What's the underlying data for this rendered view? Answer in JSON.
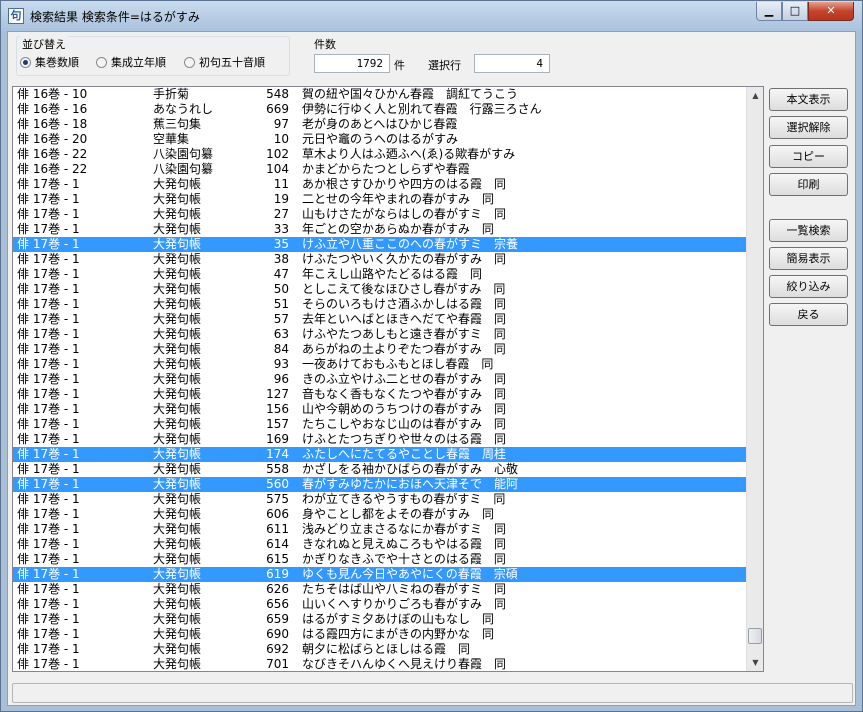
{
  "window": {
    "title": "検索結果 検索条件=はるがすみ",
    "app_icon": "句",
    "minimize": "▁",
    "maximize": "□",
    "close": "✕"
  },
  "sort": {
    "label": "並び替え",
    "options": [
      {
        "label": "集巻数順",
        "selected": true
      },
      {
        "label": "集成立年順",
        "selected": false
      },
      {
        "label": "初句五十音順",
        "selected": false
      }
    ]
  },
  "count": {
    "label": "件数",
    "value": "1792",
    "unit": "件",
    "selected_label": "選択行",
    "selected_value": "4"
  },
  "results": [
    {
      "ref": "俳 16巻 - 10",
      "collection": "手折菊",
      "num": "548",
      "text": "賀の紐や国々ひかん春霞　調紅てうこう",
      "selected": false
    },
    {
      "ref": "俳 16巻 - 16",
      "collection": "あなうれし",
      "num": "669",
      "text": "伊勢に行ゆく人と別れて春霞　行露三ろさん",
      "selected": false
    },
    {
      "ref": "俳 16巻 - 18",
      "collection": "蕉三句集",
      "num": "97",
      "text": "老が身のあとへはひかじ春霞",
      "selected": false
    },
    {
      "ref": "俳 16巻 - 20",
      "collection": "空華集",
      "num": "10",
      "text": "元日や竈のうへのはるがすみ",
      "selected": false
    },
    {
      "ref": "俳 16巻 - 22",
      "collection": "八染園句纂",
      "num": "102",
      "text": "草木より人はふ廼ふへ(ゑ)る歟春がすみ",
      "selected": false
    },
    {
      "ref": "俳 16巻 - 22",
      "collection": "八染園句纂",
      "num": "104",
      "text": "かまどからたつとしらずや春霞",
      "selected": false
    },
    {
      "ref": "俳 17巻 - 1",
      "collection": "大発句帳",
      "num": "11",
      "text": "あか根さすひかりや四方のはる霞　同",
      "selected": false
    },
    {
      "ref": "俳 17巻 - 1",
      "collection": "大発句帳",
      "num": "19",
      "text": "二とせの今年やまれの春がすみ　同",
      "selected": false
    },
    {
      "ref": "俳 17巻 - 1",
      "collection": "大発句帳",
      "num": "27",
      "text": "山もけさたがならはしの春がすミ　同",
      "selected": false
    },
    {
      "ref": "俳 17巻 - 1",
      "collection": "大発句帳",
      "num": "33",
      "text": "年ごとの空かあらぬか春がすみ　同",
      "selected": false
    },
    {
      "ref": "俳 17巻 - 1",
      "collection": "大発句帳",
      "num": "35",
      "text": "けふ立や八重ここのへの春がすミ　宗養",
      "selected": true
    },
    {
      "ref": "俳 17巻 - 1",
      "collection": "大発句帳",
      "num": "38",
      "text": "けふたつやいく久かたの春がすみ　同",
      "selected": false
    },
    {
      "ref": "俳 17巻 - 1",
      "collection": "大発句帳",
      "num": "47",
      "text": "年こえし山路やたどるはる霞　同",
      "selected": false
    },
    {
      "ref": "俳 17巻 - 1",
      "collection": "大発句帳",
      "num": "50",
      "text": "としこえて後なほひさし春がすみ　同",
      "selected": false
    },
    {
      "ref": "俳 17巻 - 1",
      "collection": "大発句帳",
      "num": "51",
      "text": "そらのいろもけさ酒ふかしはる霞　同",
      "selected": false
    },
    {
      "ref": "俳 17巻 - 1",
      "collection": "大発句帳",
      "num": "57",
      "text": "去年といへばとほきへだてや春霞　同",
      "selected": false
    },
    {
      "ref": "俳 17巻 - 1",
      "collection": "大発句帳",
      "num": "63",
      "text": "けふやたつあしもと遠き春がすミ　同",
      "selected": false
    },
    {
      "ref": "俳 17巻 - 1",
      "collection": "大発句帳",
      "num": "84",
      "text": "あらがねの土よりぞたつ春がすみ　同",
      "selected": false
    },
    {
      "ref": "俳 17巻 - 1",
      "collection": "大発句帳",
      "num": "93",
      "text": "一夜あけておもふもとほし春霞　同",
      "selected": false
    },
    {
      "ref": "俳 17巻 - 1",
      "collection": "大発句帳",
      "num": "96",
      "text": "きのふ立やけふ二とせの春がすみ　同",
      "selected": false
    },
    {
      "ref": "俳 17巻 - 1",
      "collection": "大発句帳",
      "num": "127",
      "text": "音もなく香もなくたつや春がすみ　同",
      "selected": false
    },
    {
      "ref": "俳 17巻 - 1",
      "collection": "大発句帳",
      "num": "156",
      "text": "山や今朝めのうちつけの春がすみ　同",
      "selected": false
    },
    {
      "ref": "俳 17巻 - 1",
      "collection": "大発句帳",
      "num": "157",
      "text": "たちこしやおなじ山のは春がすみ　同",
      "selected": false
    },
    {
      "ref": "俳 17巻 - 1",
      "collection": "大発句帳",
      "num": "169",
      "text": "けふとたつちぎりや世々のはる霞　同",
      "selected": false
    },
    {
      "ref": "俳 17巻 - 1",
      "collection": "大発句帳",
      "num": "174",
      "text": "ふたしへにたてるやことし春霞　周桂",
      "selected": true
    },
    {
      "ref": "俳 17巻 - 1",
      "collection": "大発句帳",
      "num": "558",
      "text": "かざしをる袖かひばらの春がすみ　心敬",
      "selected": false
    },
    {
      "ref": "俳 17巻 - 1",
      "collection": "大発句帳",
      "num": "560",
      "text": "春がすみゆたかにおほへ天津そで　能阿",
      "selected": true
    },
    {
      "ref": "俳 17巻 - 1",
      "collection": "大発句帳",
      "num": "575",
      "text": "わが立てきるやうすもの春がすミ　同",
      "selected": false
    },
    {
      "ref": "俳 17巻 - 1",
      "collection": "大発句帳",
      "num": "606",
      "text": "身やことし都をよその春がすみ　同",
      "selected": false
    },
    {
      "ref": "俳 17巻 - 1",
      "collection": "大発句帳",
      "num": "611",
      "text": "浅みどり立まさるなにか春がすミ　同",
      "selected": false
    },
    {
      "ref": "俳 17巻 - 1",
      "collection": "大発句帳",
      "num": "614",
      "text": "きなれぬと見えぬころもやはる霞　同",
      "selected": false
    },
    {
      "ref": "俳 17巻 - 1",
      "collection": "大発句帳",
      "num": "615",
      "text": "かぎりなきふでや十さとのはる霞　同",
      "selected": false
    },
    {
      "ref": "俳 17巻 - 1",
      "collection": "大発句帳",
      "num": "619",
      "text": "ゆくも見ん今日やあやにくの春霞　宗碩",
      "selected": true
    },
    {
      "ref": "俳 17巻 - 1",
      "collection": "大発句帳",
      "num": "626",
      "text": "たちそはば山や八ミねの春がすミ　同",
      "selected": false
    },
    {
      "ref": "俳 17巻 - 1",
      "collection": "大発句帳",
      "num": "656",
      "text": "山いくへすりかりごろも春がすみ　同",
      "selected": false
    },
    {
      "ref": "俳 17巻 - 1",
      "collection": "大発句帳",
      "num": "659",
      "text": "はるがすミ夕あけぼの山もなし　同",
      "selected": false
    },
    {
      "ref": "俳 17巻 - 1",
      "collection": "大発句帳",
      "num": "690",
      "text": "はる霞四方にまがきの内野かな　同",
      "selected": false
    },
    {
      "ref": "俳 17巻 - 1",
      "collection": "大発句帳",
      "num": "692",
      "text": "朝夕に松ばらとほしはる霞　同",
      "selected": false
    },
    {
      "ref": "俳 17巻 - 1",
      "collection": "大発句帳",
      "num": "701",
      "text": "なびきそハんゆくへ見えけり春霞　同",
      "selected": false
    }
  ],
  "scrollbar": {
    "up": "▲",
    "down": "▼"
  },
  "buttons": {
    "show_text": "本文表示",
    "clear_selection": "選択解除",
    "copy": "コピー",
    "print": "印刷",
    "list_search": "一覧検索",
    "simple_view": "簡易表示",
    "narrow": "絞り込み",
    "back": "戻る"
  },
  "status": {
    "text": ""
  },
  "colors": {
    "selection": "#3399ff",
    "title_bar": "#aac2dd",
    "close_button": "#c4452c"
  }
}
